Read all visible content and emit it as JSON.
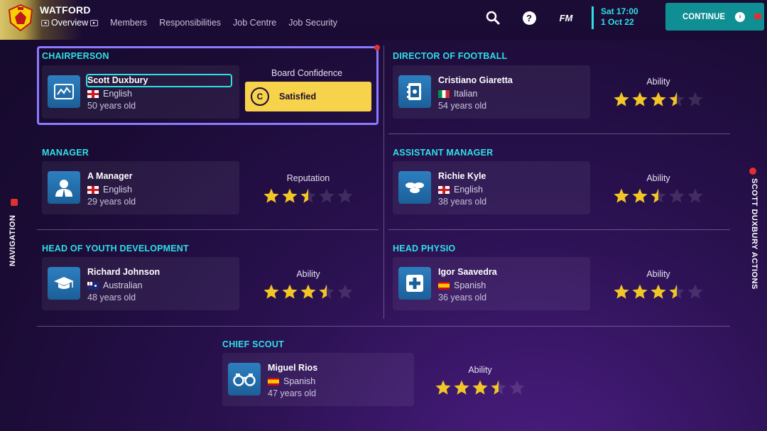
{
  "header": {
    "club": "WATFORD",
    "tabs": [
      {
        "label": "Overview",
        "active": true
      },
      {
        "label": "Members",
        "active": false
      },
      {
        "label": "Responsibilities",
        "active": false
      },
      {
        "label": "Job Centre",
        "active": false
      },
      {
        "label": "Job Security",
        "active": false
      }
    ],
    "fm_logo": "FM",
    "day_time": "Sat 17:00",
    "date": "1 Oct 22",
    "continue_label": "CONTINUE"
  },
  "side": {
    "left_label": "NAVIGATION",
    "right_label": "SCOTT DUXBURY ACTIONS"
  },
  "colors": {
    "accent": "#2ee0e6",
    "confidence": "#f7d24b",
    "continue": "#0f8f93",
    "highlight": "#8a7bff",
    "star": "#f2c625"
  },
  "sections": {
    "chairperson": {
      "title": "CHAIRPERSON",
      "name": "Scott Duxbury",
      "nationality": "English",
      "age": "50 years old",
      "icon": "chart-icon",
      "confidence_label": "Board Confidence",
      "confidence_icon": "C",
      "confidence_value": "Satisfied"
    },
    "director": {
      "title": "DIRECTOR OF FOOTBALL",
      "name": "Cristiano Giaretta",
      "nationality": "Italian",
      "age": "54 years old",
      "icon": "tactics-book-icon",
      "rating_label": "Ability",
      "stars": 3.5
    },
    "manager": {
      "title": "MANAGER",
      "name": "A Manager",
      "nationality": "English",
      "age": "29 years old",
      "icon": "person-icon",
      "rating_label": "Reputation",
      "stars": 2.5
    },
    "assistant": {
      "title": "ASSISTANT MANAGER",
      "name": "Richie Kyle",
      "nationality": "English",
      "age": "38 years old",
      "icon": "cones-icon",
      "rating_label": "Ability",
      "stars": 2.5
    },
    "youth": {
      "title": "HEAD OF YOUTH DEVELOPMENT",
      "name": "Richard Johnson",
      "nationality": "Australian",
      "age": "48 years old",
      "icon": "graduation-cap-icon",
      "rating_label": "Ability",
      "stars": 3.5
    },
    "physio": {
      "title": "HEAD PHYSIO",
      "name": "Igor Saavedra",
      "nationality": "Spanish",
      "age": "36 years old",
      "icon": "medical-cross-icon",
      "rating_label": "Ability",
      "stars": 3.5
    },
    "scout": {
      "title": "CHIEF SCOUT",
      "name": "Miguel Rios",
      "nationality": "Spanish",
      "age": "47 years old",
      "icon": "binoculars-icon",
      "rating_label": "Ability",
      "stars": 3.5
    }
  }
}
